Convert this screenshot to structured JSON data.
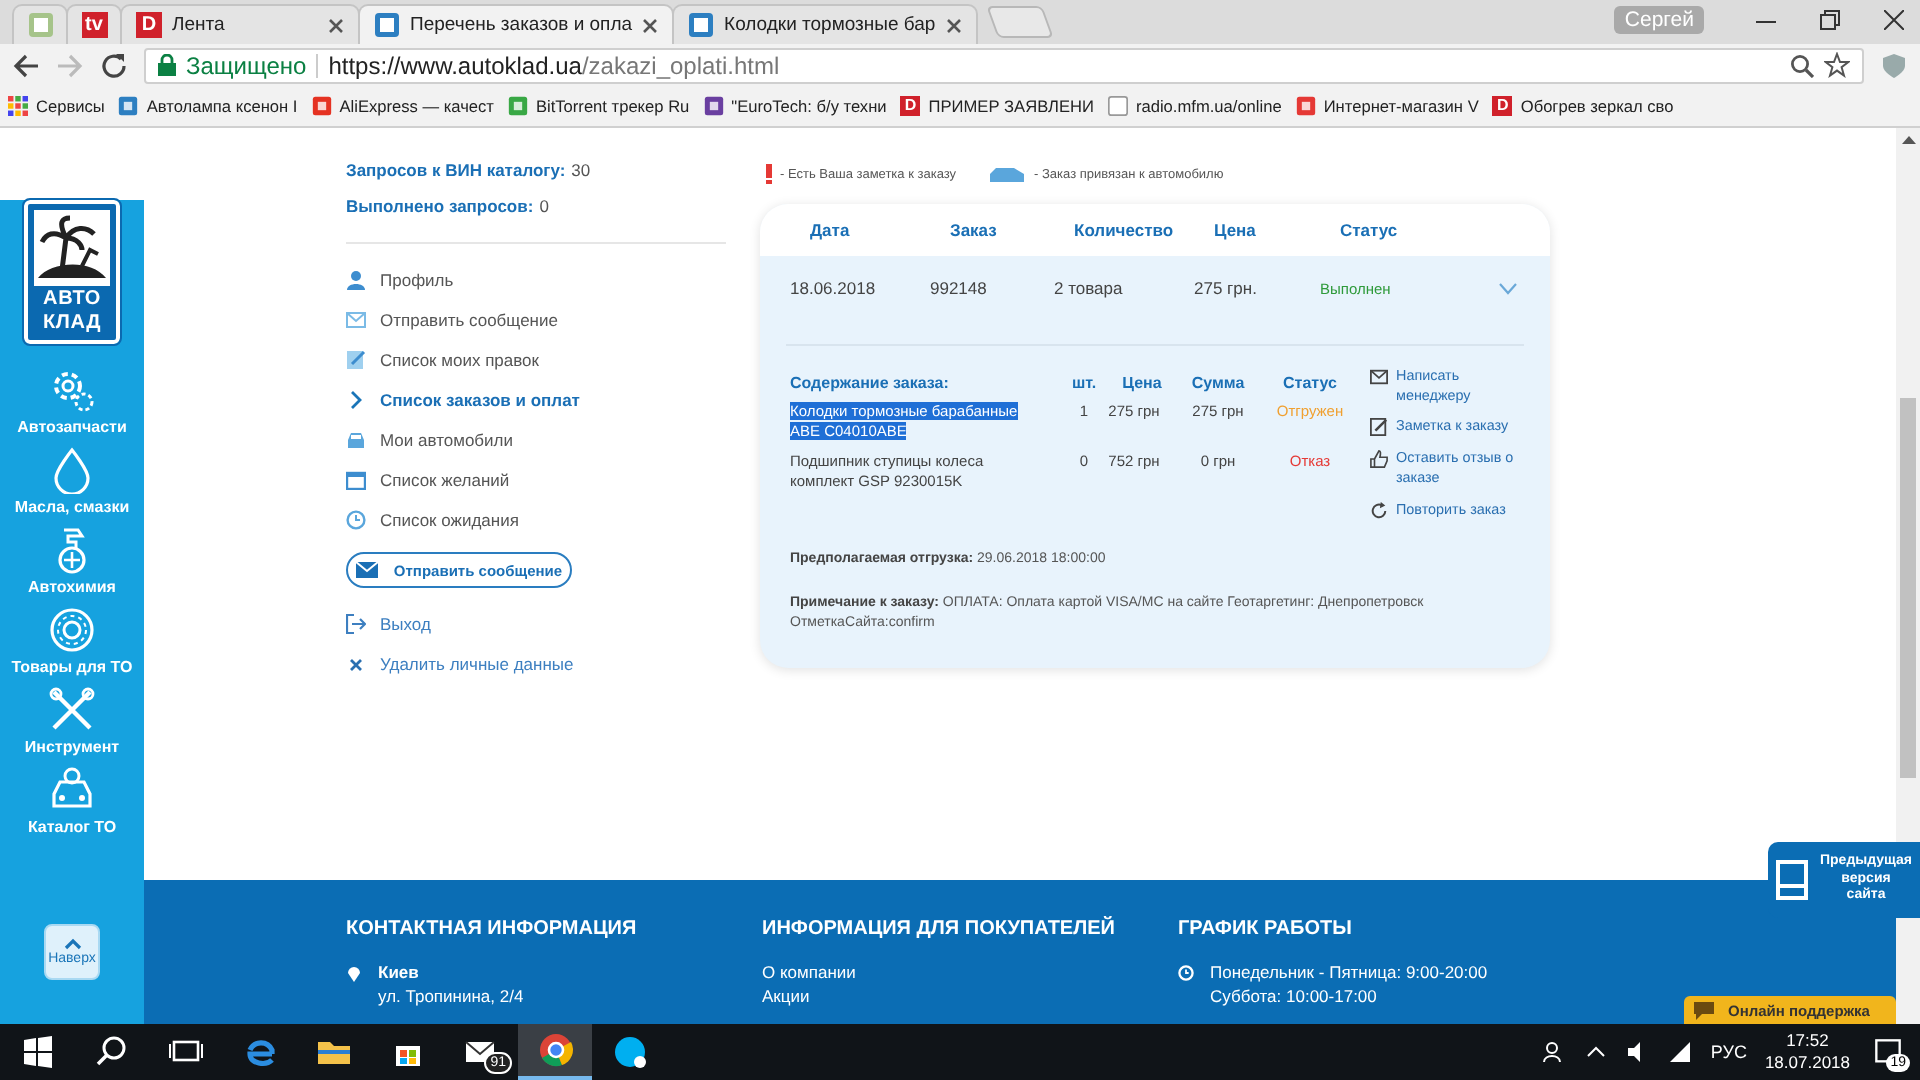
{
  "browser": {
    "tabs": [
      {
        "selected": false
      },
      {
        "badge": "tv",
        "selected": false
      },
      {
        "badge": "D",
        "title": "Лента",
        "selected": false
      },
      {
        "title": "Перечень заказов и опла",
        "selected": true
      },
      {
        "title": "Колодки тормозные бар",
        "selected": false
      }
    ],
    "profile": "Сергей",
    "secure": "Защищено",
    "url_host": "https://www.autoklad.ua",
    "url_path": "/zakazi_oplati.html",
    "bookmarks": [
      {
        "title": "Сервисы"
      },
      {
        "title": "Автолампа ксенон I"
      },
      {
        "title": "AliExpress — качест"
      },
      {
        "title": "BitTorrent трекер Ru"
      },
      {
        "title": "\"EuroTech: б/у техни"
      },
      {
        "badge": "D",
        "title": "ПРИМЕР ЗАЯВЛЕНИ"
      },
      {
        "title": "radio.mfm.ua/online"
      },
      {
        "title": "Интернет-магазин V"
      },
      {
        "badge": "D",
        "title": "Обогрев зеркал сво"
      }
    ]
  },
  "sidebar": {
    "logo": [
      "АВТО",
      "КЛАД"
    ],
    "categories": [
      "Автозапчасти",
      "Масла, смазки",
      "Автохимия",
      "Товары для ТО",
      "Инструмент",
      "Каталог ТО"
    ],
    "up_button": "Наверх"
  },
  "account": {
    "stats": [
      {
        "label": "Запросов к ВИН каталогу:",
        "value": "30"
      },
      {
        "label": "Выполнено запросов:",
        "value": "0"
      }
    ],
    "menu": [
      {
        "label": "Профиль",
        "selected": false
      },
      {
        "label": "Отправить сообщение",
        "selected": false
      },
      {
        "label": "Список моих правок",
        "selected": false
      },
      {
        "label": "Список заказов и оплат",
        "selected": true
      },
      {
        "label": "Мои автомобили",
        "selected": false
      },
      {
        "label": "Список желаний",
        "selected": false
      },
      {
        "label": "Список ожидания",
        "selected": false
      }
    ],
    "send_button": "Отправить сообщение",
    "links": [
      "Выход",
      "Удалить личные данные"
    ]
  },
  "legend": [
    "- Есть Ваша заметка к заказу",
    "- Заказ привязан к автомобилю"
  ],
  "order": {
    "columns": [
      "Дата",
      "Заказ",
      "Количество",
      "Цена",
      "Статус"
    ],
    "date": "18.06.2018",
    "number": "992148",
    "quantity": "2 товара",
    "price": "275 грн.",
    "status": "Выполнен",
    "expanded": true,
    "detail_columns": [
      "Содержание заказа:",
      "шт.",
      "Цена",
      "Сумма",
      "Статус"
    ],
    "items": [
      {
        "name": "Колодки тормозные барабанные ABE C04010ABE",
        "qty": "1",
        "price": "275 грн",
        "sum": "275 грн",
        "status": "Отгружен",
        "color": "#f0a030",
        "selected": true
      },
      {
        "name": "Подшипник ступицы колеса комплект GSP 9230015K",
        "qty": "0",
        "price": "752 грн",
        "sum": "0 грн",
        "status": "Отказ",
        "color": "#e53935",
        "selected": false
      }
    ],
    "actions": [
      "Написать менеджеру",
      "Заметка к заказу",
      "Оставить отзыв о заказе",
      "Повторить заказ"
    ],
    "shipping_label": "Предполагаемая отгрузка:",
    "shipping_value": "29.06.2018 18:00:00",
    "note_label": "Примечание к заказу:",
    "note_value": "ОПЛАТА: Оплата картой VISA/MC на сайте Геотаргетинг: Днепропетровск ОтметкаСайта:confirm"
  },
  "footer": {
    "contacts": {
      "title": "КОНТАКТНАЯ ИНФОРМАЦИЯ",
      "city": "Киев",
      "address": "ул. Тропинина, 2/4"
    },
    "info": {
      "title": "ИНФОРМАЦИЯ ДЛЯ ПОКУПАТЕЛЕЙ",
      "links": [
        "О компании",
        "Акции"
      ]
    },
    "schedule": {
      "title": "ГРАФИК РАБОТЫ",
      "lines": [
        "Понедельник - Пятница: 9:00-20:00",
        "Суббота: 10:00-17:00"
      ]
    }
  },
  "previous_version": "Предыдущая версия сайта",
  "support": "Онлайн поддержка",
  "taskbar": {
    "apps": [
      {
        "selected": false
      },
      {
        "selected": false
      },
      {
        "selected": false
      },
      {
        "badge": "91",
        "selected": false
      },
      {
        "selected": true
      },
      {
        "selected": false
      }
    ],
    "language": "РУС",
    "time": "17:52",
    "date": "18.07.2018",
    "notifications": "19"
  }
}
